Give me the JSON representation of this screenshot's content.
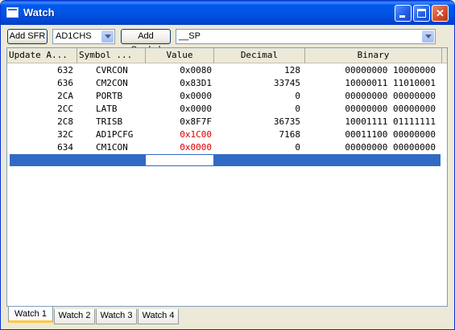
{
  "window": {
    "title": "Watch"
  },
  "toolbar": {
    "add_sfr_label": "Add SFR",
    "sfr_selected": "AD1CHS",
    "add_symbol_label": "Add Symbol",
    "symbol_selected": "__SP"
  },
  "columns": {
    "address": "Update A...",
    "symbol": "Symbol ...",
    "value": "Value",
    "decimal": "Decimal",
    "binary": "Binary"
  },
  "rows": [
    {
      "address": "632",
      "symbol": "CVRCON",
      "value": "0x0080",
      "decimal": "128",
      "binary": "00000000 10000000",
      "changed": false
    },
    {
      "address": "636",
      "symbol": "CM2CON",
      "value": "0x83D1",
      "decimal": "33745",
      "binary": "10000011 11010001",
      "changed": false
    },
    {
      "address": "2CA",
      "symbol": "PORTB",
      "value": "0x0000",
      "decimal": "0",
      "binary": "00000000 00000000",
      "changed": false
    },
    {
      "address": "2CC",
      "symbol": "LATB",
      "value": "0x0000",
      "decimal": "0",
      "binary": "00000000 00000000",
      "changed": false
    },
    {
      "address": "2C8",
      "symbol": "TRISB",
      "value": "0x8F7F",
      "decimal": "36735",
      "binary": "10001111 01111111",
      "changed": false
    },
    {
      "address": "32C",
      "symbol": "AD1PCFG",
      "value": "0x1C00",
      "decimal": "7168",
      "binary": "00011100 00000000",
      "changed": true
    },
    {
      "address": "634",
      "symbol": "CM1CON",
      "value": "0x0000",
      "decimal": "0",
      "binary": "00000000 00000000",
      "changed": true
    }
  ],
  "tabs": [
    "Watch 1",
    "Watch 2",
    "Watch 3",
    "Watch 4"
  ],
  "active_tab": 0,
  "colors": {
    "changed_value": "#e00000",
    "selection": "#316ac5",
    "titlebar": "#0055e5"
  }
}
